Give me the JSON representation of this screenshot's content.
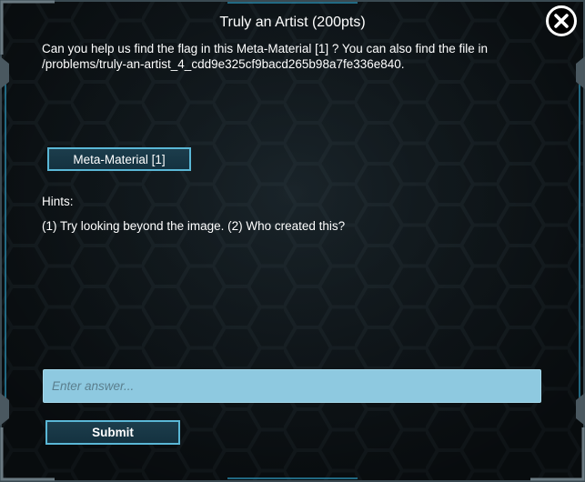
{
  "dialog": {
    "title": "Truly an Artist (200pts)",
    "description_line1": "Can you help us find the flag in this Meta-Material [1] ? You can also find the file in",
    "description_line2": "/problems/truly-an-artist_4_cdd9e325cf9bacd265b98a7fe336e840.",
    "close_icon": "close-x-icon"
  },
  "file_button": {
    "label": "Meta-Material [1]"
  },
  "hints": {
    "label": "Hints:",
    "text": "(1) Try looking beyond the image. (2) Who created this?"
  },
  "answer": {
    "placeholder": "Enter answer...",
    "value": ""
  },
  "submit": {
    "label": "Submit"
  },
  "colors": {
    "background": "#121a1f",
    "hex_line": "#1f2a30",
    "accent": "#5ab7d6",
    "input_bg": "#8ec9e0",
    "button_bg": "#1c3d4c"
  }
}
